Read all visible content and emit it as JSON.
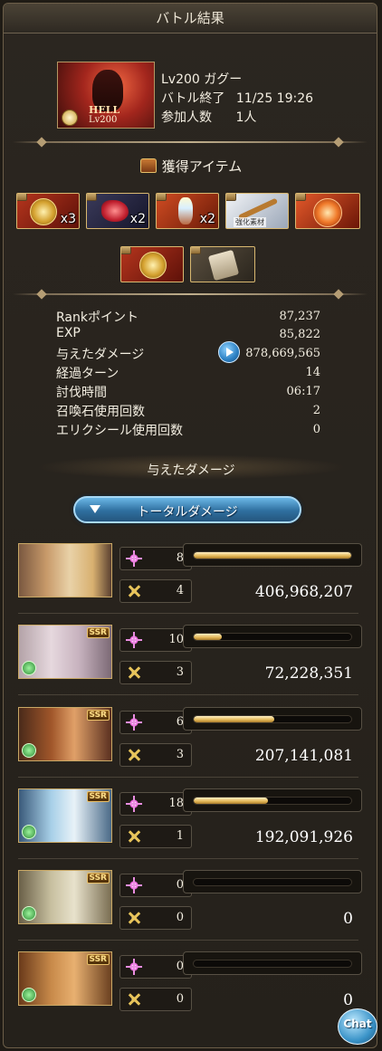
{
  "title": "バトル結果",
  "battle": {
    "enemy_name": "Lv200 ガグー",
    "enemy_badge": "HELL",
    "enemy_level_badge": "Lv200",
    "end_label": "バトル終了",
    "end_time": "11/25 19:26",
    "participants_label": "参加人数",
    "participants_value": "1人"
  },
  "items": {
    "header": "獲得アイテム",
    "row1": [
      {
        "icon": "gold-medal-icon",
        "qty": "x3"
      },
      {
        "icon": "red-beast-claw-icon",
        "qty": "x2"
      },
      {
        "icon": "crystal-shard-icon",
        "qty": "x2"
      },
      {
        "icon": "bow-weapon-icon",
        "qty": "",
        "tag": "強化素材"
      },
      {
        "icon": "fire-orb-icon",
        "qty": ""
      }
    ],
    "row2": [
      {
        "icon": "gold-medal-icon",
        "qty": ""
      },
      {
        "icon": "scroll-ticket-icon",
        "qty": ""
      }
    ]
  },
  "stats": [
    {
      "label": "Rankポイント",
      "value": "87,237"
    },
    {
      "label": "EXP",
      "value": "85,822"
    },
    {
      "label": "与えたダメージ",
      "value": "878,669,565"
    },
    {
      "label": "経過ターン",
      "value": "14"
    },
    {
      "label": "討伐時間",
      "value": "06:17"
    },
    {
      "label": "召喚石使用回数",
      "value": "2"
    },
    {
      "label": "エリクシール使用回数",
      "value": "0"
    }
  ],
  "damage": {
    "header": "与えたダメージ",
    "total_button": "トータルダメージ",
    "members": [
      {
        "portrait": "main-characters",
        "ssr": "",
        "ability_count": "8",
        "ougi_count": "4",
        "fill": 1.0,
        "damage": "406,968,207"
      },
      {
        "portrait": "character-2",
        "ssr": "SSR",
        "ability_count": "10",
        "ougi_count": "3",
        "fill": 0.177,
        "damage": "72,228,351"
      },
      {
        "portrait": "character-3",
        "ssr": "SSR",
        "ability_count": "6",
        "ougi_count": "3",
        "fill": 0.509,
        "damage": "207,141,081"
      },
      {
        "portrait": "character-4",
        "ssr": "SSR",
        "ability_count": "18",
        "ougi_count": "1",
        "fill": 0.472,
        "damage": "192,091,926"
      },
      {
        "portrait": "character-5",
        "ssr": "SSR",
        "ability_count": "0",
        "ougi_count": "0",
        "fill": 0.0,
        "damage": "0"
      },
      {
        "portrait": "character-6",
        "ssr": "SSR",
        "ability_count": "0",
        "ougi_count": "0",
        "fill": 0.0,
        "damage": "0"
      }
    ]
  },
  "chat_label": "Chat",
  "colors": {
    "accent_blue": "#2f6f9f",
    "bar_gold": "#e2b656",
    "panel_bg": "#25211b"
  }
}
